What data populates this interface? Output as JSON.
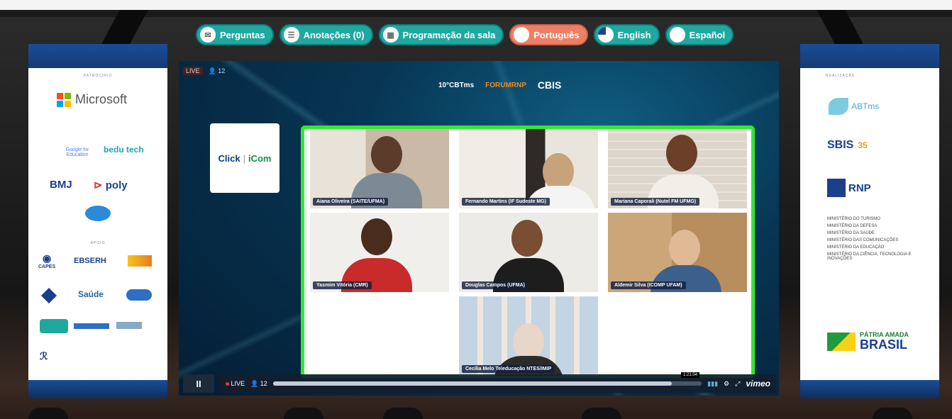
{
  "menu": {
    "items": [
      {
        "label": "Perguntas",
        "icon": "chat-icon",
        "active": false
      },
      {
        "label": "Anotações (0)",
        "icon": "notes-icon",
        "active": false
      },
      {
        "label": "Programação da sala",
        "icon": "schedule-icon",
        "active": false
      },
      {
        "label": "Português",
        "icon": "flag-brazil-icon",
        "active": true
      },
      {
        "label": "English",
        "icon": "flag-usa-icon",
        "active": false
      },
      {
        "label": "Español",
        "icon": "flag-spain-icon",
        "active": false
      }
    ]
  },
  "left_banner": {
    "sections": [
      "PATROCÍNIO",
      "APOIO"
    ],
    "logos": [
      "Microsoft",
      "Google for Education",
      "bedu tech",
      "BMJ",
      "poly",
      "EBSERH",
      "Saúde",
      "CAPES"
    ]
  },
  "right_banner": {
    "section": "REALIZAÇÃO",
    "logos": [
      "ABTms",
      "SBIS",
      "RNP"
    ],
    "ministries": [
      "MINISTÉRIO DO TURISMO",
      "MINISTÉRIO DA DEFESA",
      "MINISTÉRIO DA SAÚDE",
      "MINISTÉRIO DAS COMUNICAÇÕES",
      "MINISTÉRIO DA EDUCAÇÃO",
      "MINISTÉRIO DA CIÊNCIA, TECNOLOGIA E INOVAÇÕES"
    ],
    "brand_top": "PÁTRIA AMADA",
    "brand_bottom": "BRASIL"
  },
  "stream": {
    "live_label": "LIVE",
    "viewers": "12",
    "event_logos": [
      "10°CBTms",
      "FORUMRNP",
      "CBIS"
    ],
    "partner_card": {
      "left": "Click",
      "right": "iCom"
    },
    "participants": [
      {
        "name": "Aiana Oliveira (SAITE/UFMA)"
      },
      {
        "name": "Fernando Martins (IF Sudeste MG)"
      },
      {
        "name": "Mariana Caporali (Nutel FM UFMG)"
      },
      {
        "name": "Yasmim Vitória (CMR)"
      },
      {
        "name": "Douglas Campos (UFMA)"
      },
      {
        "name": "Aldemir Silva (ICOMP UFAM)"
      },
      {
        "name": "Cecília Melo Teleducação NTES/IMIP"
      }
    ]
  },
  "player": {
    "pause_symbol": "II",
    "live_label": "LIVE",
    "viewers": "12",
    "time_tip": "1:21:04",
    "brand": "vimeo",
    "progress": 0.93
  }
}
